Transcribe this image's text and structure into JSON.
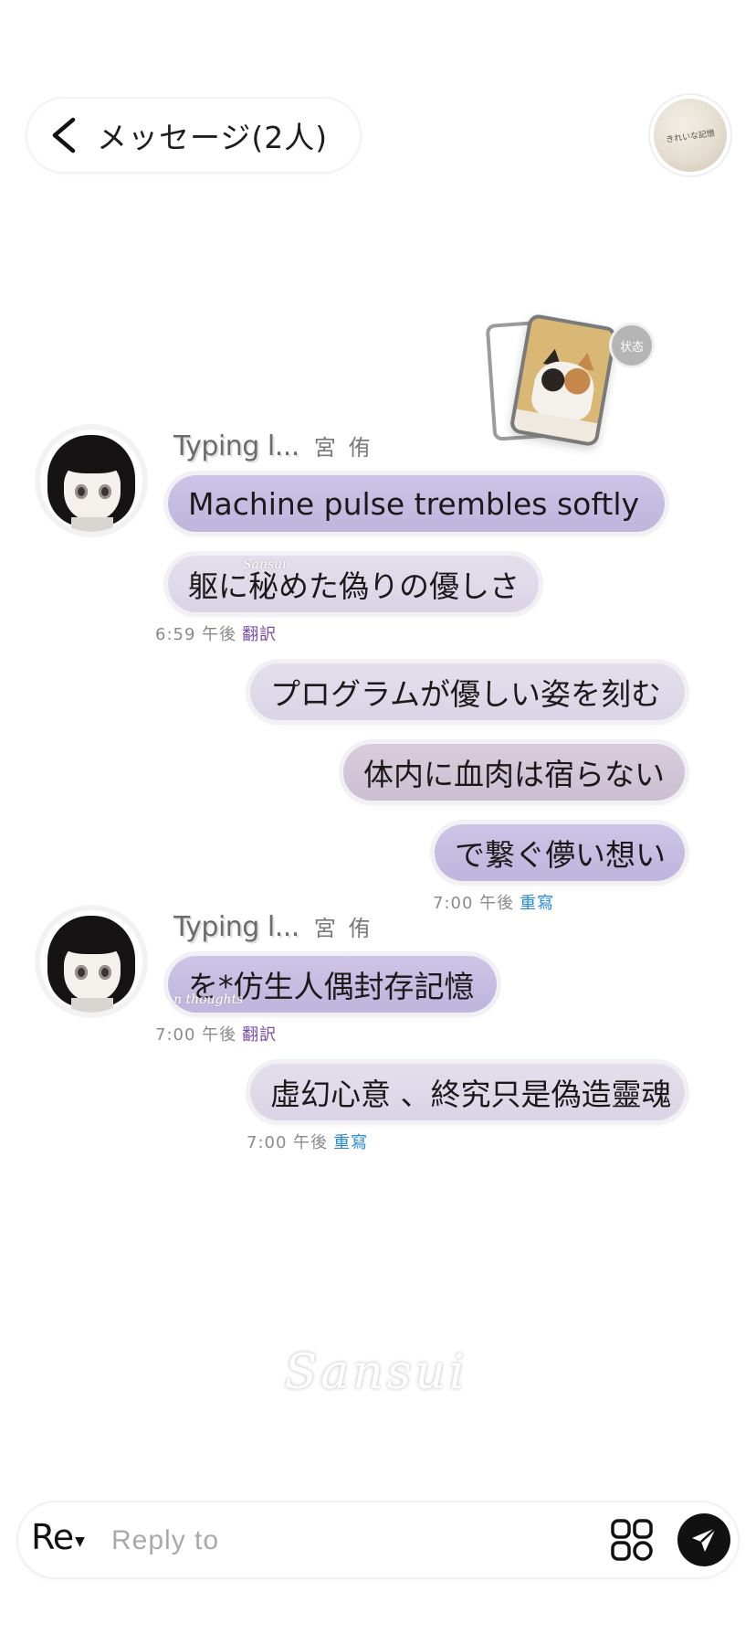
{
  "header": {
    "title": "メッセージ(2人)",
    "avatar_text": "きれいな記憶"
  },
  "status": {
    "badge_label": "状态"
  },
  "conversation": {
    "groups": [
      {
        "side": "left",
        "typing_label": "Typing l...",
        "username": "宮 侑",
        "bubbles": [
          "Machine pulse trembles softly",
          "躯に秘めた偽りの優しさ"
        ],
        "time": "6:59 午後",
        "action": "翻訳"
      },
      {
        "side": "right",
        "bubbles": [
          "プログラムが優しい姿を刻む",
          "体内に血肉は宿らない",
          "で繋ぐ儚い想い"
        ],
        "time": "7:00 午後",
        "action": "重寫"
      },
      {
        "side": "left",
        "typing_label": "Typing l...",
        "username": "宮 侑",
        "bubbles": [
          "を*仿生人偶封存記憶"
        ],
        "time": "7:00 午後",
        "action": "翻訳"
      },
      {
        "side": "right",
        "bubbles": [
          "虛幻心意 、終究只是偽造靈魂"
        ],
        "time": "7:00 午後",
        "action": "重寫"
      }
    ]
  },
  "watermarks": {
    "main": "Sansui",
    "small_1": "Sansui",
    "small_2": "n thoughts"
  },
  "composer": {
    "mode_label": "Re",
    "placeholder": "Reply to"
  },
  "icons": {
    "back": "chevron-left-icon",
    "apps": "apps-grid-icon",
    "send": "paper-plane-icon"
  },
  "colors": {
    "bubble_purple": "#c7bde2",
    "bubble_lilac": "#dfd9e9",
    "bubble_mauve": "#d3c6d8",
    "translate_action": "#7b4aa8",
    "rewrite_action": "#2b8ad6"
  }
}
